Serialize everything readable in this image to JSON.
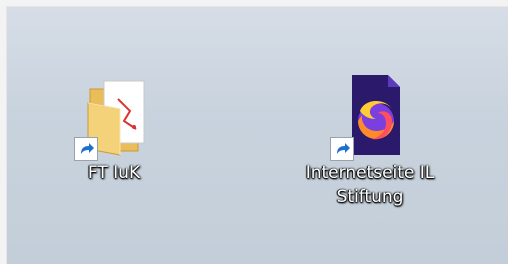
{
  "desktop": {
    "icons": [
      {
        "label_lines": [
          "FT IuK"
        ],
        "icon": "folder-with-documents-icon",
        "shortcut": true
      },
      {
        "label_lines": [
          "Internetseite IL",
          "Stiftung"
        ],
        "icon": "firefox-document-icon",
        "shortcut": true
      }
    ]
  },
  "colors": {
    "desktop_bg": "#c9d3de",
    "label_text": "#ffffff",
    "shortcut_arrow": "#1f6fd1"
  }
}
